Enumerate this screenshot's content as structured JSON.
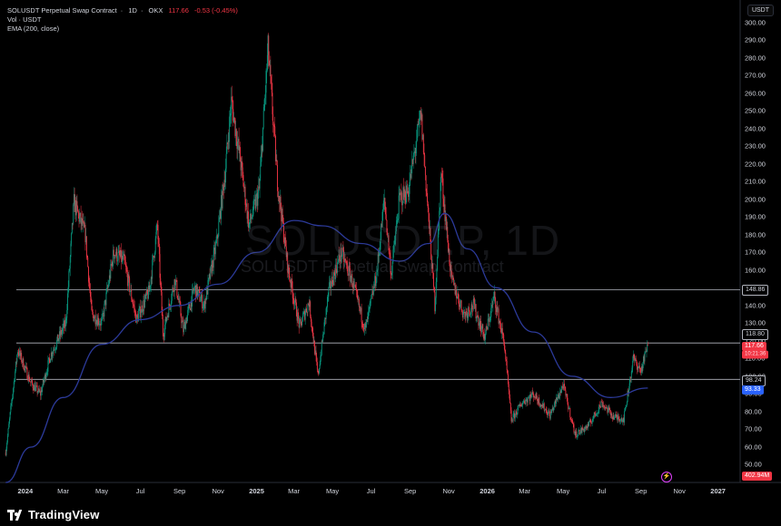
{
  "header": {
    "symbol": "SOLUSDT Perpetual Swap Contract",
    "interval": "1D",
    "exchange": "OKX",
    "last_price": "117.66",
    "change": "-0.53 (-0.45%)",
    "vol_label": "Vol · USDT",
    "ema_label": "EMA (200, close)"
  },
  "currency_button": "USDT",
  "watermark": {
    "ticker": "SOLUSDT.P, 1D",
    "description": "SOLUSDT Perpetual Swap Contract"
  },
  "footer": {
    "brand": "TradingView"
  },
  "price_labels": {
    "level_high": "148.86",
    "level_mid": "118.80",
    "last": "117.66",
    "countdown": "10:21:36",
    "level_low": "98.24",
    "ema": "93.33",
    "volume": "402.94M"
  },
  "colors": {
    "up": "#089981",
    "down": "#f23645",
    "ema": "#2c3a9a",
    "level_line": "#b2b5be",
    "background": "#000000"
  },
  "chart_data": {
    "type": "candlestick",
    "yaxis_ticks": [
      "50.00",
      "60.00",
      "70.00",
      "80.00",
      "90.00",
      "100.00",
      "110.00",
      "120.00",
      "130.00",
      "140.00",
      "150.00",
      "160.00",
      "170.00",
      "180.00",
      "190.00",
      "200.00",
      "210.00",
      "220.00",
      "230.00",
      "240.00",
      "250.00",
      "260.00",
      "270.00",
      "280.00",
      "290.00",
      "300.00"
    ],
    "ylim": [
      40,
      310
    ],
    "xaxis_ticks": [
      "2024",
      "Mar",
      "May",
      "Jul",
      "Sep",
      "Nov",
      "2025",
      "Mar",
      "May",
      "Jul",
      "Sep",
      "Nov",
      "2026",
      "Mar",
      "May",
      "Jul",
      "Sep",
      "Nov",
      "2027"
    ],
    "xaxis_year_ticks": [
      "2024",
      "2025",
      "2026",
      "2027"
    ],
    "horizontal_levels": [
      148.86,
      118.8,
      98.24
    ],
    "last_price": 117.66,
    "ema_last": 93.33,
    "ema_period": 200,
    "price_path": [
      [
        "2023-12-01",
        57
      ],
      [
        "2023-12-20",
        115
      ],
      [
        "2024-01-10",
        96
      ],
      [
        "2024-01-25",
        90
      ],
      [
        "2024-02-10",
        112
      ],
      [
        "2024-03-05",
        130
      ],
      [
        "2024-03-18",
        198
      ],
      [
        "2024-04-05",
        180
      ],
      [
        "2024-04-15",
        135
      ],
      [
        "2024-05-01",
        130
      ],
      [
        "2024-05-20",
        170
      ],
      [
        "2024-06-05",
        165
      ],
      [
        "2024-06-25",
        132
      ],
      [
        "2024-07-15",
        148
      ],
      [
        "2024-07-28",
        185
      ],
      [
        "2024-08-06",
        124
      ],
      [
        "2024-08-25",
        155
      ],
      [
        "2024-09-07",
        126
      ],
      [
        "2024-09-25",
        150
      ],
      [
        "2024-10-10",
        140
      ],
      [
        "2024-10-30",
        176
      ],
      [
        "2024-11-12",
        215
      ],
      [
        "2024-11-22",
        255
      ],
      [
        "2024-12-05",
        225
      ],
      [
        "2024-12-20",
        185
      ],
      [
        "2025-01-05",
        205
      ],
      [
        "2025-01-19",
        285
      ],
      [
        "2025-02-03",
        210
      ],
      [
        "2025-02-20",
        160
      ],
      [
        "2025-03-10",
        128
      ],
      [
        "2025-03-25",
        142
      ],
      [
        "2025-04-08",
        100
      ],
      [
        "2025-04-25",
        148
      ],
      [
        "2025-05-15",
        170
      ],
      [
        "2025-05-31",
        155
      ],
      [
        "2025-06-22",
        126
      ],
      [
        "2025-07-10",
        158
      ],
      [
        "2025-07-22",
        200
      ],
      [
        "2025-08-02",
        158
      ],
      [
        "2025-08-15",
        200
      ],
      [
        "2025-08-29",
        205
      ],
      [
        "2025-09-18",
        248
      ],
      [
        "2025-10-10",
        140
      ],
      [
        "2025-10-20",
        215
      ],
      [
        "2025-11-05",
        155
      ],
      [
        "2025-11-25",
        135
      ],
      [
        "2025-12-10",
        140
      ],
      [
        "2025-12-28",
        122
      ],
      [
        "2026-01-12",
        145
      ],
      [
        "2026-01-28",
        118
      ],
      [
        "2026-02-08",
        75
      ],
      [
        "2026-02-25",
        85
      ],
      [
        "2026-03-15",
        90
      ],
      [
        "2026-04-10",
        78
      ],
      [
        "2026-05-01",
        95
      ],
      [
        "2026-05-20",
        67
      ],
      [
        "2026-06-10",
        72
      ],
      [
        "2026-07-01",
        85
      ],
      [
        "2026-07-20",
        77
      ],
      [
        "2026-08-05",
        76
      ],
      [
        "2026-08-20",
        110
      ],
      [
        "2026-09-01",
        103
      ],
      [
        "2026-09-12",
        117.66
      ]
    ],
    "ema_path": [
      [
        "2023-12-01",
        40
      ],
      [
        "2024-01-10",
        60
      ],
      [
        "2024-03-01",
        88
      ],
      [
        "2024-05-01",
        118
      ],
      [
        "2024-07-01",
        132
      ],
      [
        "2024-09-01",
        140
      ],
      [
        "2024-11-01",
        152
      ],
      [
        "2025-01-01",
        170
      ],
      [
        "2025-03-01",
        188
      ],
      [
        "2025-04-15",
        185
      ],
      [
        "2025-06-15",
        175
      ],
      [
        "2025-08-15",
        165
      ],
      [
        "2025-10-01",
        175
      ],
      [
        "2025-10-25",
        192
      ],
      [
        "2025-12-01",
        172
      ],
      [
        "2026-01-15",
        150
      ],
      [
        "2026-03-15",
        125
      ],
      [
        "2026-05-15",
        100
      ],
      [
        "2026-07-15",
        88
      ],
      [
        "2026-09-12",
        93.33
      ]
    ]
  }
}
